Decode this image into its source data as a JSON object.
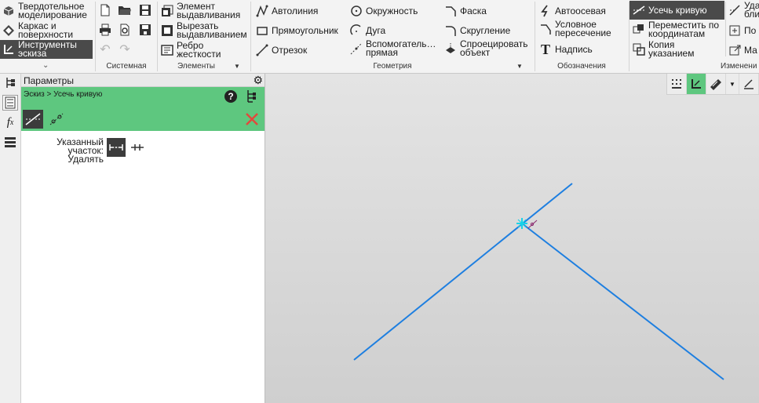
{
  "ribbon": {
    "mode_items": [
      {
        "label_1": "Твердотельное",
        "label_2": "моделирование"
      },
      {
        "label_1": "Каркас и",
        "label_2": "поверхности"
      },
      {
        "label_1": "Инструменты",
        "label_2": "эскиза"
      }
    ],
    "groups": {
      "system": "Системная",
      "elements": "Элементы",
      "geometry": "Геометрия",
      "annotations": "Обозначения",
      "edit": "Изменени"
    },
    "elements": [
      {
        "label_1": "Элемент",
        "label_2": "выдавливания"
      },
      {
        "label_1": "Вырезать",
        "label_2": "выдавливанием"
      },
      {
        "label_1": "Ребро",
        "label_2": "жесткости"
      }
    ],
    "geometry": {
      "autoline": "Автолиния",
      "rectangle": "Прямоугольник",
      "segment": "Отрезок",
      "circle": "Окружность",
      "arc": "Дуга",
      "aux_line_1": "Вспомогатель…",
      "aux_line_2": "прямая",
      "chamfer": "Фаска",
      "fillet": "Скругление",
      "project_1": "Спроецировать",
      "project_2": "объект"
    },
    "annotations": {
      "axis": "Автоосевая",
      "cond_1": "Условное",
      "cond_2": "пересечение",
      "text": "Надпись"
    },
    "edit": {
      "trim": "Усечь кривую",
      "move_1": "Переместить по",
      "move_2": "координатам",
      "copy_1": "Копия",
      "copy_2": "указанием",
      "cut_del_1": "Уда",
      "cut_del_2": "бли",
      "po": "По",
      "ma": "Ма"
    }
  },
  "panel": {
    "title": "Параметры",
    "breadcrumb": "Эскиз > Усечь кривую",
    "field_label": "Указанный участок:",
    "field_value": "Удалять"
  },
  "colors": {
    "accent_green": "#5ec77f",
    "curve_blue": "#1e7fe0",
    "cursor_cyan": "#19d3e8",
    "close_red": "#e04a3c"
  }
}
